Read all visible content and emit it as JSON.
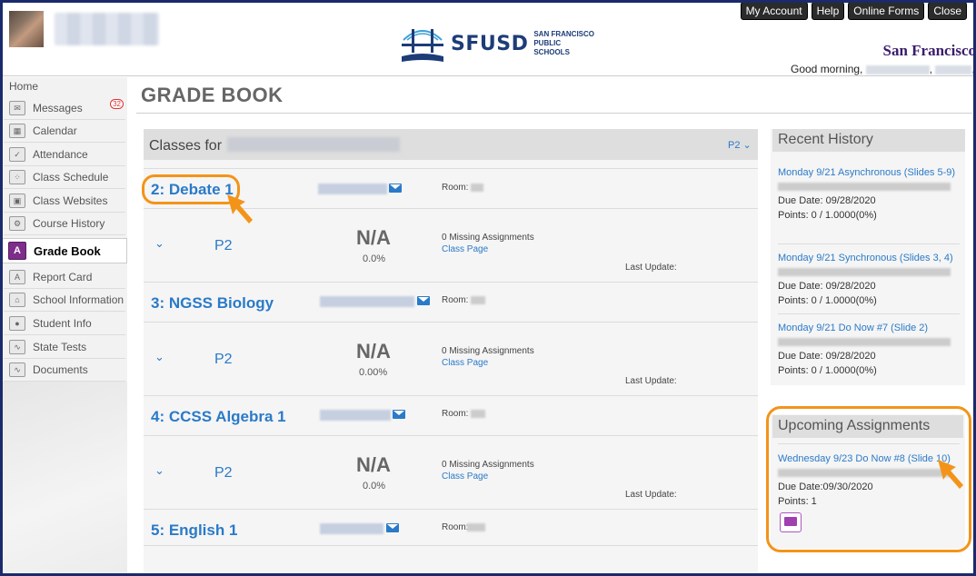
{
  "header": {
    "logo_text": "SFUSD",
    "logo_sub": "SAN FRANCISCO PUBLIC SCHOOLS",
    "district_name": "San Francisco",
    "greeting": "Good morning,",
    "buttons": [
      "My Account",
      "Help",
      "Online Forms",
      "Close"
    ]
  },
  "sidebar": {
    "home": "Home",
    "items": [
      {
        "label": "Messages",
        "icon": "envelope-icon",
        "badge": "32"
      },
      {
        "label": "Calendar",
        "icon": "calendar-icon"
      },
      {
        "label": "Attendance",
        "icon": "checkmark-icon"
      },
      {
        "label": "Class Schedule",
        "icon": "schedule-icon"
      },
      {
        "label": "Class Websites",
        "icon": "website-icon"
      },
      {
        "label": "Course History",
        "icon": "history-icon"
      },
      {
        "label": "Grade Book",
        "icon": "gradebook-icon",
        "active": true
      },
      {
        "label": "Report Card",
        "icon": "report-card-icon"
      },
      {
        "label": "School Information",
        "icon": "school-icon"
      },
      {
        "label": "Student Info",
        "icon": "student-icon"
      },
      {
        "label": "State Tests",
        "icon": "chart-icon"
      },
      {
        "label": "Documents",
        "icon": "document-icon"
      }
    ]
  },
  "main": {
    "title": "GRADE BOOK",
    "classes_label": "Classes for",
    "period_filter": "P2",
    "room_label": "Room:",
    "classes": [
      {
        "name": "2: Debate 1",
        "period": "P2",
        "grade": "N/A",
        "percent": "0.0%",
        "missing": "0 Missing Assignments",
        "class_page": "Class Page",
        "last_update": "Last Update:"
      },
      {
        "name": "3: NGSS Biology",
        "period": "P2",
        "grade": "N/A",
        "percent": "0.00%",
        "missing": "0 Missing Assignments",
        "class_page": "Class Page",
        "last_update": "Last Update:"
      },
      {
        "name": "4: CCSS Algebra 1",
        "period": "P2",
        "grade": "N/A",
        "percent": "0.0%",
        "missing": "0 Missing Assignments",
        "class_page": "Class Page",
        "last_update": "Last Update:"
      },
      {
        "name": "5: English 1"
      }
    ]
  },
  "recent_history": {
    "title": "Recent History",
    "items": [
      {
        "title": "Monday 9/21 Asynchronous (Slides 5-9)",
        "due": "Due Date: 09/28/2020",
        "points": "Points: 0 / 1.0000(0%)"
      },
      {
        "title": "Monday 9/21 Synchronous (Slides 3, 4)",
        "due": "Due Date: 09/28/2020",
        "points": "Points: 0 / 1.0000(0%)"
      },
      {
        "title": "Monday 9/21 Do Now #7 (Slide 2)",
        "due": "Due Date: 09/28/2020",
        "points": "Points: 0 / 1.0000(0%)"
      }
    ]
  },
  "upcoming": {
    "title": "Upcoming Assignments",
    "items": [
      {
        "title": "Wednesday 9/23 Do Now #8 (Slide 10)",
        "due": "Due Date:09/30/2020",
        "points": "Points: 1"
      }
    ]
  },
  "colors": {
    "link": "#2a7ac8",
    "annotation": "#f39419",
    "active_icon": "#7d2d8a"
  }
}
